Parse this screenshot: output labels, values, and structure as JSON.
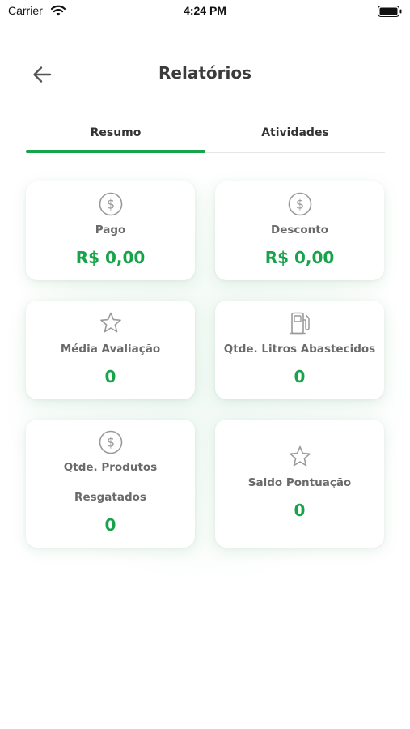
{
  "status_bar": {
    "carrier": "Carrier",
    "time": "4:24 PM"
  },
  "header": {
    "title": "Relatórios",
    "back_icon": "arrow-left-icon"
  },
  "tabs": [
    {
      "label": "Resumo",
      "active": true
    },
    {
      "label": "Atividades",
      "active": false
    }
  ],
  "cards": [
    {
      "icon": "dollar-circle-icon",
      "label": "Pago",
      "value": "R$ 0,00"
    },
    {
      "icon": "dollar-circle-icon",
      "label": "Desconto",
      "value": "R$ 0,00"
    },
    {
      "icon": "star-icon",
      "label": "Média Avaliação",
      "value": "0"
    },
    {
      "icon": "fuel-pump-icon",
      "label": "Qtde. Litros Abastecidos",
      "value": "0"
    },
    {
      "icon": "dollar-circle-icon",
      "label_line1": "Qtde. Produtos",
      "label_line2": "Resgatados",
      "value": "0"
    },
    {
      "icon": "star-icon",
      "label": "Saldo Pontuação",
      "value": "0"
    }
  ],
  "colors": {
    "accent": "#16a34a",
    "title_text": "#3b3b3b",
    "label_text": "#6a6a6a",
    "icon_stroke": "#9a9a9a"
  }
}
